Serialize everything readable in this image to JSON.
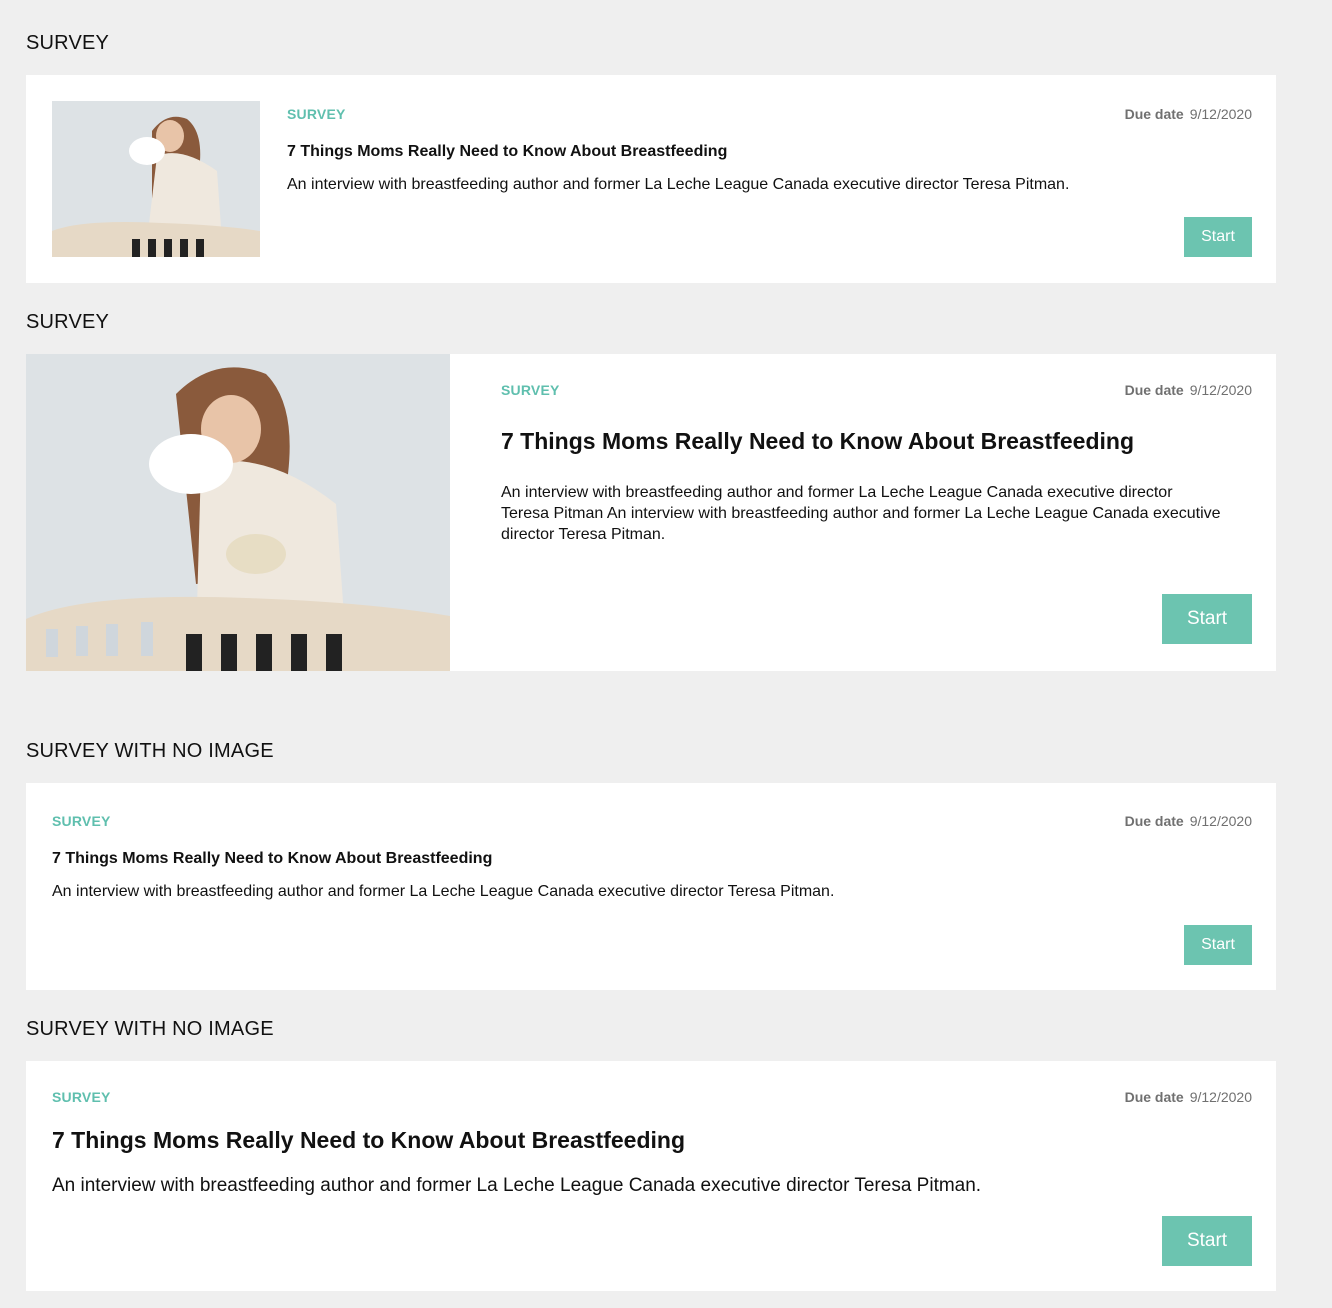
{
  "sections": [
    {
      "heading": "SURVEY",
      "card": {
        "tag": "SURVEY",
        "due_label": "Due date",
        "due_date": "9/12/2020",
        "title": "7 Things Moms Really Need to Know About Breastfeeding",
        "description": "An interview with breastfeeding author and former La Leche League Canada executive director Teresa Pitman.",
        "button": "Start"
      }
    },
    {
      "heading": "SURVEY",
      "card": {
        "tag": "SURVEY",
        "due_label": "Due date",
        "due_date": "9/12/2020",
        "title": "7 Things Moms Really Need to Know About Breastfeeding",
        "description": "An interview with breastfeeding author and former La Leche League Canada executive director Teresa Pitman An interview with breastfeeding author and former La Leche League Canada executive director Teresa Pitman.",
        "button": "Start"
      }
    },
    {
      "heading": "SURVEY WITH NO IMAGE",
      "card": {
        "tag": "SURVEY",
        "due_label": "Due date",
        "due_date": "9/12/2020",
        "title": "7 Things Moms Really Need to Know About Breastfeeding",
        "description": "An interview with breastfeeding author and former La Leche League Canada executive director Teresa Pitman.",
        "button": "Start"
      }
    },
    {
      "heading": "SURVEY WITH NO IMAGE",
      "card": {
        "tag": "SURVEY",
        "due_label": "Due date",
        "due_date": "9/12/2020",
        "title": "7 Things Moms Really Need to Know About Breastfeeding",
        "description": "An interview with breastfeeding author and former La Leche League Canada executive director Teresa Pitman.",
        "button": "Start"
      }
    }
  ],
  "colors": {
    "background": "#efefef",
    "card": "#ffffff",
    "accent": "#6cc4b0",
    "tag": "#5fbfae",
    "due": "#707070"
  },
  "image_subject": "woman-holding-baby-over-crib-photo"
}
